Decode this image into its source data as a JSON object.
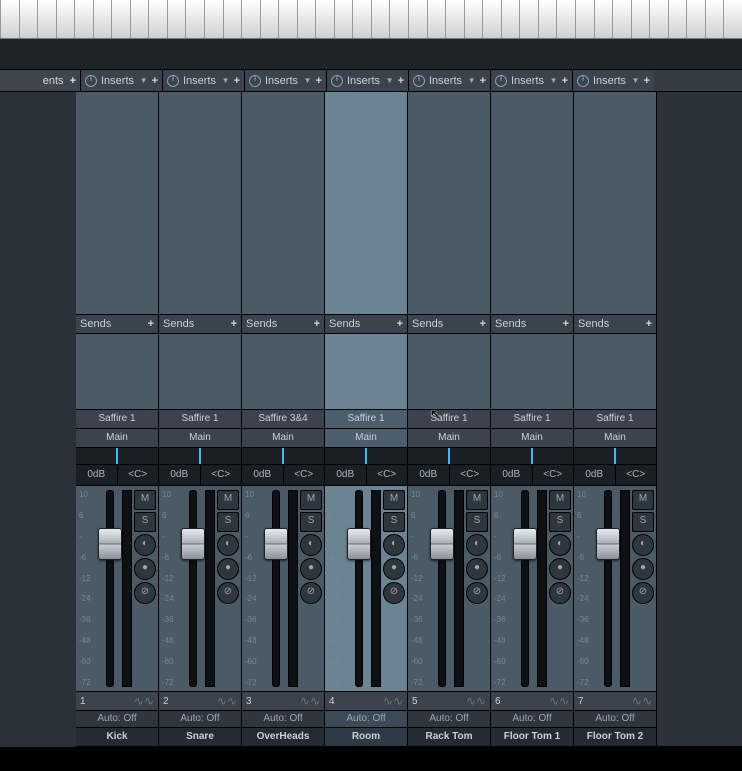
{
  "toolbar_left_label": "ents",
  "inserts_label": "Inserts",
  "sends_label": "Sends",
  "db_label": "0dB",
  "pan_label": "<C>",
  "scale_marks": [
    "10",
    "6",
    "-",
    "-6",
    "-12",
    "-24",
    "-36",
    "-48",
    "-60",
    "-72"
  ],
  "mute_label": "M",
  "solo_label": "S",
  "channels": [
    {
      "io1": "Saffire 1",
      "io2": "Main",
      "num": "1",
      "auto": "Auto: Off",
      "name": "Kick",
      "sel": false
    },
    {
      "io1": "Saffire 1",
      "io2": "Main",
      "num": "2",
      "auto": "Auto: Off",
      "name": "Snare",
      "sel": false
    },
    {
      "io1": "Saffire 3&4",
      "io2": "Main",
      "num": "3",
      "auto": "Auto: Off",
      "name": "OverHeads",
      "sel": false
    },
    {
      "io1": "Saffire 1",
      "io2": "Main",
      "num": "4",
      "auto": "Auto: Off",
      "name": "Room",
      "sel": true
    },
    {
      "io1": "Saffire 1",
      "io2": "Main",
      "num": "5",
      "auto": "Auto: Off",
      "name": "Rack Tom",
      "sel": false
    },
    {
      "io1": "Saffire 1",
      "io2": "Main",
      "num": "6",
      "auto": "Auto: Off",
      "name": "Floor Tom 1",
      "sel": false
    },
    {
      "io1": "Saffire 1",
      "io2": "Main",
      "num": "7",
      "auto": "Auto: Off",
      "name": "Floor Tom 2",
      "sel": false
    }
  ]
}
